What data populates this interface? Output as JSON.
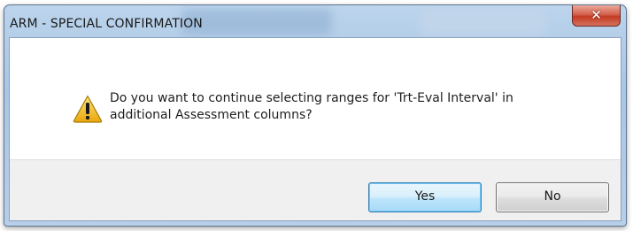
{
  "dialog": {
    "title": "ARM - SPECIAL CONFIRMATION",
    "close_glyph": "✕",
    "icon": "warning-icon",
    "message_line1": "Do you want to continue selecting ranges for 'Trt-Eval Interval' in",
    "message_line2": "additional Assessment columns?",
    "buttons": {
      "yes_label": "Yes",
      "no_label": "No"
    }
  },
  "colors": {
    "titlebar": "#b3cde8",
    "close_button": "#c9452d",
    "warning_icon": "#f5c518",
    "default_button_border": "#3c7fb1"
  }
}
